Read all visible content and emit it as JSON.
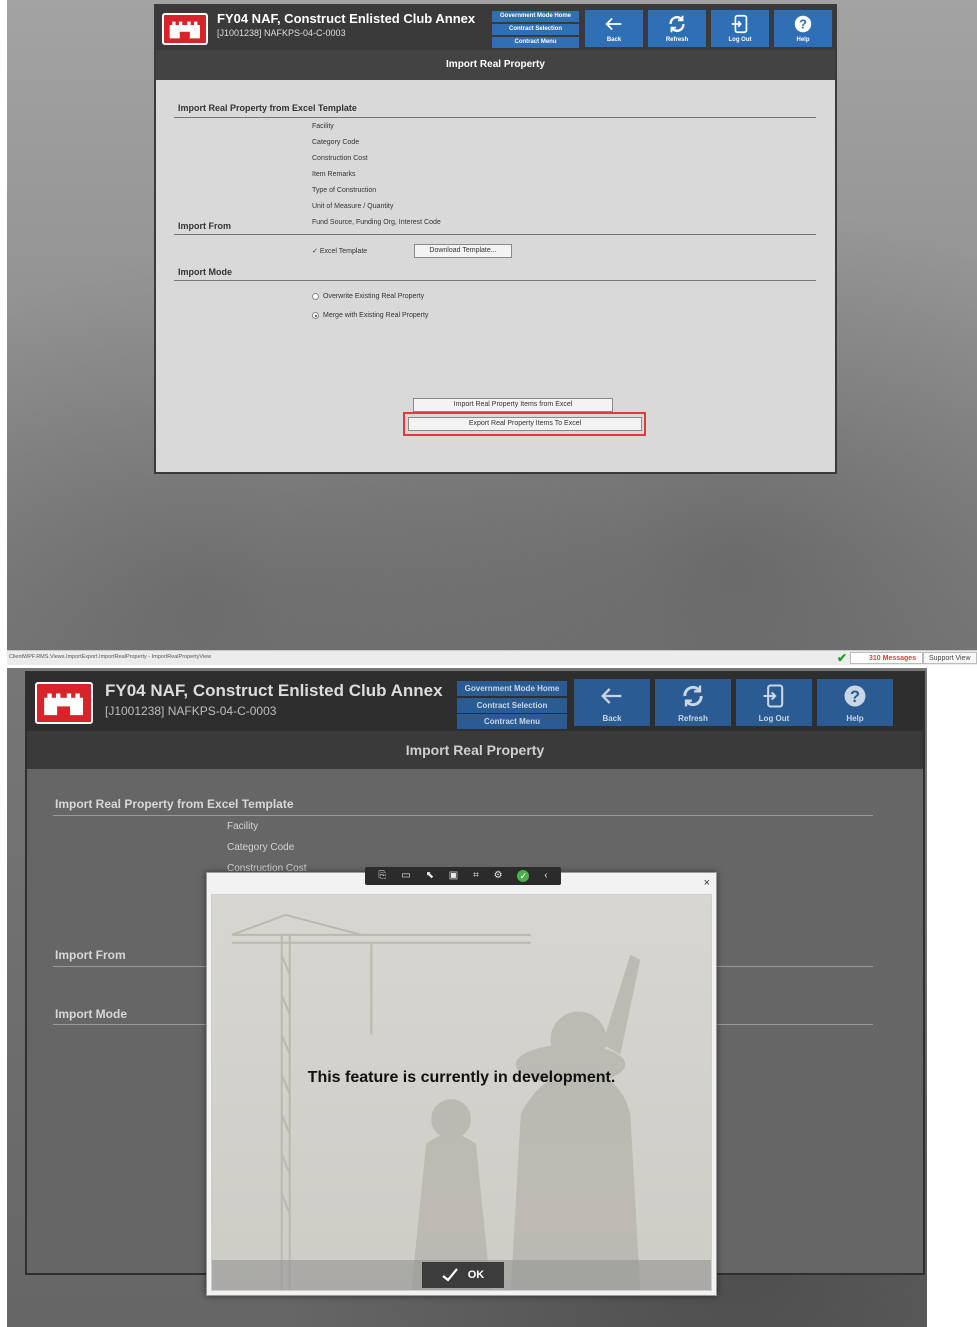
{
  "app": {
    "project_title": "FY04 NAF, Construct Enlisted Club Annex",
    "project_subtitle": "[J1001238] NAFKPS-04-C-0003",
    "nav_stack": [
      "Government Mode Home",
      "Contract Selection",
      "Contract Menu"
    ],
    "toolbar": [
      {
        "label": "Back",
        "icon": "back-arrow-icon"
      },
      {
        "label": "Refresh",
        "icon": "refresh-icon"
      },
      {
        "label": "Log Out",
        "icon": "logout-icon"
      },
      {
        "label": "Help",
        "icon": "help-icon"
      }
    ],
    "page_title": "Import Real Property"
  },
  "form": {
    "section_template": "Import Real Property from Excel Template",
    "template_fields": [
      "Facility",
      "Category Code",
      "Construction Cost",
      "Item Remarks",
      "Type of Construction",
      "Unit of Measure / Quantity",
      "Fund Source, Funding Org, Interest Code"
    ],
    "section_import_from": "Import From",
    "excel_template_label": "Excel Template",
    "excel_template_checked": true,
    "download_template_label": "Download Template...",
    "section_import_mode": "Import Mode",
    "mode_options": [
      {
        "label": "Overwrite Existing Real Property",
        "selected": false
      },
      {
        "label": "Merge with Existing Real Property",
        "selected": true
      }
    ],
    "import_button_label": "Import Real Property Items from Excel",
    "export_button_label": "Export Real Property Items To Excel"
  },
  "status": {
    "path": "ClientWPF.RMS.Views.ImportExport.ImportRealProperty - ImportRealPropertyView",
    "messages": "310 Messages",
    "support": "Support View"
  },
  "dialog": {
    "message": "This feature is currently in development.",
    "ok_label": "OK",
    "close_glyph": "×",
    "tool_icons": [
      "select-icon",
      "record-icon",
      "pointer-icon",
      "frame-icon",
      "inspect-icon",
      "settings-icon",
      "check-icon",
      "collapse-icon"
    ]
  },
  "colors": {
    "accent_blue": "#2f6fb6",
    "logo_red": "#d8232a",
    "highlight_red": "#e23a3a",
    "status_ok": "#1e9e2e"
  }
}
